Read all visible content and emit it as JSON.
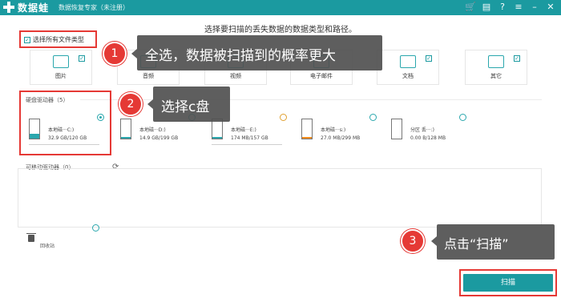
{
  "header": {
    "app_name": "数据蛙",
    "subtitle": "数据恢复专家（未注册）",
    "icons": [
      "cart-icon",
      "gift-icon",
      "help-icon",
      "menu-icon",
      "minimize-icon",
      "close-icon"
    ]
  },
  "instruction": "选择要扫描的丢失数据的数据类型和路径。",
  "select_all": {
    "label": "选择所有文件类型",
    "checked": true
  },
  "file_types": [
    {
      "label": "图片",
      "checked": true
    },
    {
      "label": "音频",
      "checked": true
    },
    {
      "label": "视频",
      "checked": true
    },
    {
      "label": "电子邮件",
      "checked": true
    },
    {
      "label": "文档",
      "checked": true
    },
    {
      "label": "其它",
      "checked": true
    }
  ],
  "callouts": [
    {
      "number": "1",
      "text": "全选，数据被扫描到的概率更大"
    },
    {
      "number": "2",
      "text": "选择c盘"
    },
    {
      "number": "3",
      "text": "点击“扫描”"
    }
  ],
  "hard_drives": {
    "title": "硬盘驱动器（5）",
    "items": [
      {
        "name": "本地磁···C:)",
        "size": "32.9 GB/120 GB",
        "selected": true,
        "fill_color": "#2aa7ad",
        "fill_fraction": 0.27
      },
      {
        "name": "本地磁···D:)",
        "size": "14.9 GB/199 GB",
        "selected": false,
        "fill_color": "#2aa7ad",
        "fill_fraction": 0.07
      },
      {
        "name": "本地磁···E:)",
        "size": "174 MB/157 GB",
        "selected": false,
        "fill_color": "#2aa7ad",
        "fill_fraction": 0.01
      },
      {
        "name": "本地磁···s:)",
        "size": "27.0 MB/299 MB",
        "selected": false,
        "fill_color": "#ff8c1a",
        "fill_fraction": 0.09
      },
      {
        "name": "分区 丢···:)",
        "size": "0.00  B/128 MB",
        "selected": false,
        "fill_color": "#ff8c1a",
        "fill_fraction": 0.0
      }
    ]
  },
  "removable": {
    "title": "可移动驱动器（0）"
  },
  "recycle_bin": {
    "label": "回收站"
  },
  "scan_button": {
    "label": "扫描"
  },
  "colors": {
    "accent": "#1b9aa0",
    "highlight": "#e53935",
    "callout_bg": "#505050"
  }
}
